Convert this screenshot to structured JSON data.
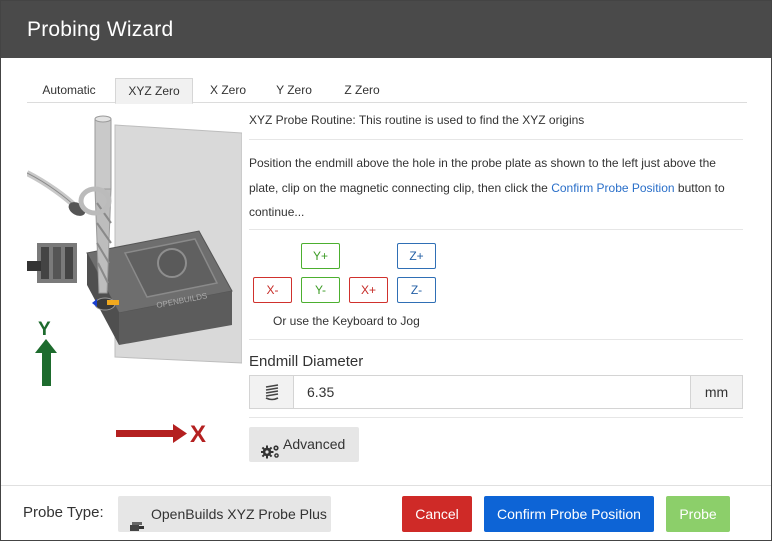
{
  "dialog": {
    "title": "Probing Wizard"
  },
  "tabs": [
    {
      "label": "Automatic",
      "active": false
    },
    {
      "label": "XYZ Zero",
      "active": true
    },
    {
      "label": "X Zero",
      "active": false
    },
    {
      "label": "Y Zero",
      "active": false
    },
    {
      "label": "Z Zero",
      "active": false
    }
  ],
  "illustration": {
    "plate_text": "OPENBUILDS",
    "y_axis_label": "Y",
    "x_axis_label": "X"
  },
  "content": {
    "routine_text": "XYZ Probe Routine: This routine is used to find the XYZ origins",
    "instructions_part1": "Position the endmill above the hole in the probe plate as shown to the left just above the plate, clip on the magnetic connecting clip, then click the ",
    "instructions_link": "Confirm Probe Position",
    "instructions_part2": " button to continue..."
  },
  "jog": {
    "y_plus": "Y+",
    "z_plus": "Z+",
    "x_minus": "X-",
    "y_minus": "Y-",
    "x_plus": "X+",
    "z_minus": "Z-",
    "hint": "Or use the Keyboard to Jog"
  },
  "endmill": {
    "label": "Endmill Diameter",
    "value": "6.35",
    "unit": "mm",
    "icon": "endmill-icon"
  },
  "advanced": {
    "label": "Advanced",
    "icon": "gears-icon"
  },
  "footer": {
    "probe_type_label": "Probe Type:",
    "probe_type_value": "OpenBuilds XYZ Probe Plus",
    "probe_type_icon": "probe-icon",
    "cancel": "Cancel",
    "confirm": "Confirm Probe Position",
    "probe": "Probe"
  },
  "colors": {
    "title_bar": "#4a4a4a",
    "cancel": "#cf2a27",
    "confirm": "#0d64d6",
    "probe": "#8ccf6a",
    "jog_green": "#4caf2f",
    "jog_red": "#d0312d",
    "jog_blue": "#2f6fb5"
  }
}
